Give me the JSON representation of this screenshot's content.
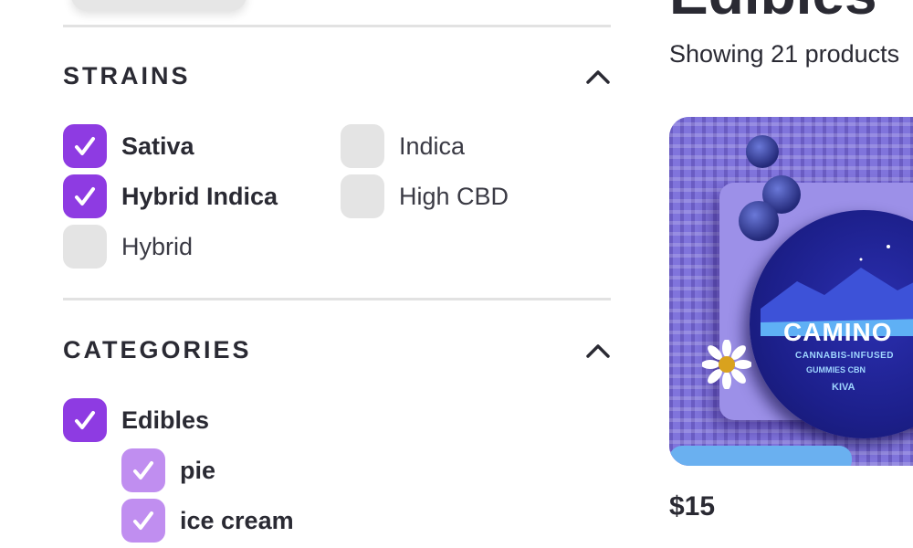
{
  "filters": {
    "strains": {
      "title": "STRAINS",
      "options": [
        {
          "label": "Sativa",
          "checked": true
        },
        {
          "label": "Indica",
          "checked": false
        },
        {
          "label": "Hybrid Indica",
          "checked": true
        },
        {
          "label": "High CBD",
          "checked": false
        },
        {
          "label": "Hybrid",
          "checked": false
        }
      ]
    },
    "categories": {
      "title": "CATEGORIES",
      "options": [
        {
          "label": "Edibles",
          "checked": true
        },
        {
          "label": "pie",
          "checked": true
        },
        {
          "label": "ice cream",
          "checked": true
        }
      ]
    }
  },
  "main": {
    "heading": "Edibles",
    "result_count": "Showing 21 products",
    "product": {
      "brand_name": "CAMINO",
      "brand_subtitle": "CANNABIS-INFUSED",
      "brand_variant": "GUMMIES CBN",
      "maker": "KIVA",
      "price": "$15"
    }
  },
  "colors": {
    "accent": "#8e3be2",
    "accent_light": "#c08ef0",
    "unchecked": "#e4e4e4"
  }
}
